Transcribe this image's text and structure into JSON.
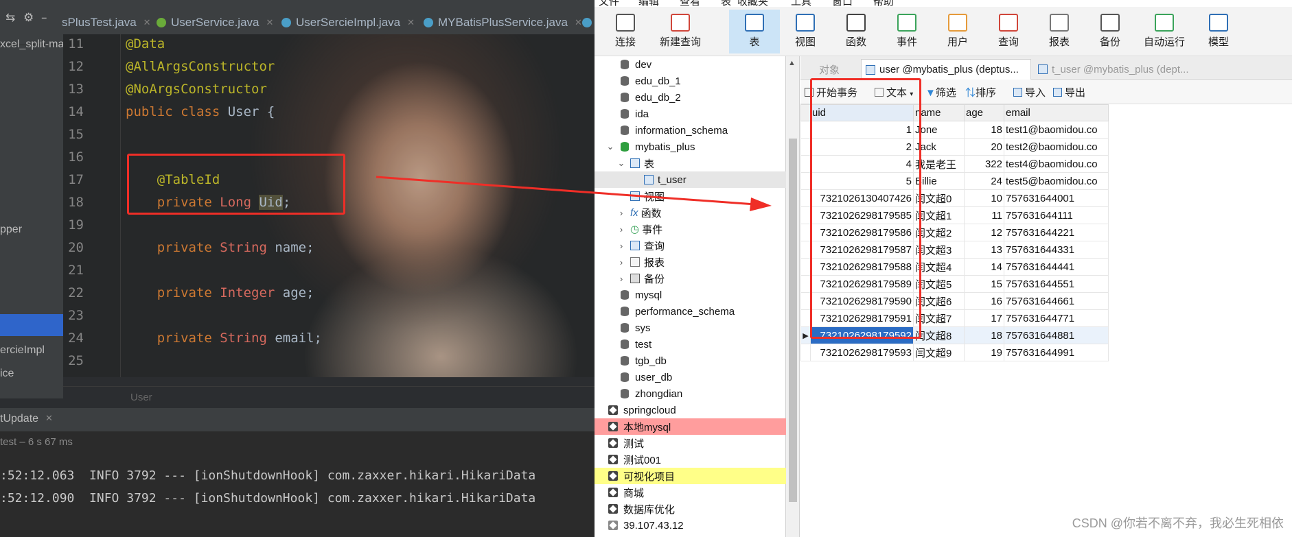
{
  "ide": {
    "tabs": [
      {
        "label": "sPlusTest.java",
        "color": "#4a9ec7"
      },
      {
        "label": "UserService.java",
        "color": "#6aab3a"
      },
      {
        "label": "UserSercieImpl.java",
        "color": "#4a9ec7"
      },
      {
        "label": "MYBatisPlusService.java",
        "color": "#4a9ec7"
      }
    ],
    "project_items": [
      "xcel_split-ma",
      "pper",
      "ercieImpl",
      "ice"
    ],
    "editor": {
      "line_numbers": [
        "11",
        "12",
        "13",
        "14",
        "15",
        "16",
        "17",
        "18",
        "19",
        "20",
        "21",
        "22",
        "23",
        "24",
        "25"
      ],
      "lines": {
        "l11": "@Data",
        "l12": "@AllArgsConstructor",
        "l13": "@NoArgsConstructor",
        "l14_kw": "public class ",
        "l14_name": "User {",
        "l17": "@TableId",
        "l18_kw": "private ",
        "l18_type": "Long ",
        "l18_field": "Uid",
        "l18_end": ";",
        "l20_kw": "private ",
        "l20_type": "String ",
        "l20_field": "name;",
        "l22_kw": "private ",
        "l22_type": "Integer ",
        "l22_field": "age;",
        "l24_kw": "private ",
        "l24_type": "String ",
        "l24_field": "email;"
      }
    },
    "breadcrumb": "User",
    "run_tab": "tUpdate",
    "run_status": "test – 6 s 67 ms",
    "console_lines": [
      ":52:12.063  INFO 3792 --- [ionShutdownHook] com.zaxxer.hikari.HikariData",
      ":52:12.090  INFO 3792 --- [ionShutdownHook] com.zaxxer.hikari.HikariData"
    ]
  },
  "navicat": {
    "menu": [
      "文件",
      "编辑",
      "查看",
      "表",
      "收藏夹",
      "工具",
      "窗口",
      "帮助"
    ],
    "toolbar": [
      {
        "label": "连接",
        "color": "#555555"
      },
      {
        "label": "新建查询",
        "color": "#d0463a"
      },
      {
        "label": "表",
        "color": "#2f6fb5"
      },
      {
        "label": "视图",
        "color": "#2f6fb5"
      },
      {
        "label": "函数",
        "color": "#444444"
      },
      {
        "label": "事件",
        "color": "#3aa35a"
      },
      {
        "label": "用户",
        "color": "#e59a3a"
      },
      {
        "label": "查询",
        "color": "#d0463a"
      },
      {
        "label": "报表",
        "color": "#777777"
      },
      {
        "label": "备份",
        "color": "#555555"
      },
      {
        "label": "自动运行",
        "color": "#3aa35a"
      },
      {
        "label": "模型",
        "color": "#2f6fb5"
      }
    ],
    "tree": {
      "databases_top": [
        "dev",
        "edu_db_1",
        "edu_db_2",
        "ida",
        "information_schema"
      ],
      "open_db": "mybatis_plus",
      "tables_group": "表",
      "selected_table": "t_user",
      "subgroups": [
        "视图",
        "函数",
        "事件",
        "查询",
        "报表",
        "备份"
      ],
      "databases_bottom": [
        "mysql",
        "performance_schema",
        "sys",
        "test",
        "tgb_db",
        "user_db",
        "zhongdian"
      ],
      "connections": [
        {
          "label": "springcloud",
          "highlight": ""
        },
        {
          "label": "本地mysql",
          "highlight": "#ff9d9d"
        },
        {
          "label": "测试",
          "highlight": ""
        },
        {
          "label": "测试001",
          "highlight": ""
        },
        {
          "label": "可视化项目",
          "highlight": "#ffff88"
        },
        {
          "label": "商城",
          "highlight": ""
        },
        {
          "label": "数据库优化",
          "highlight": ""
        },
        {
          "label": "39.107.43.12",
          "highlight": ""
        }
      ]
    },
    "obj_tabs": [
      "对象",
      "user @mybatis_plus (deptus...",
      "t_user @mybatis_plus (dept..."
    ],
    "obj_toolbar": [
      "开始事务",
      "文本",
      "筛选",
      "排序",
      "导入",
      "导出"
    ],
    "grid": {
      "columns": [
        "uid",
        "name",
        "age",
        "email"
      ],
      "rows": [
        [
          "1",
          "Jone",
          "18",
          "test1@baomidou.co"
        ],
        [
          "2",
          "Jack",
          "20",
          "test2@baomidou.co"
        ],
        [
          "4",
          "我是老王",
          "322",
          "test4@baomidou.co"
        ],
        [
          "5",
          "Billie",
          "24",
          "test5@baomidou.co"
        ],
        [
          "7321026130407426",
          "闫文超0",
          "10",
          "757631644001"
        ],
        [
          "7321026298179585",
          "闫文超1",
          "11",
          "757631644111"
        ],
        [
          "7321026298179586",
          "闫文超2",
          "12",
          "757631644221"
        ],
        [
          "7321026298179587",
          "闫文超3",
          "13",
          "757631644331"
        ],
        [
          "7321026298179588",
          "闫文超4",
          "14",
          "757631644441"
        ],
        [
          "7321026298179589",
          "闫文超5",
          "15",
          "757631644551"
        ],
        [
          "7321026298179590",
          "闫文超6",
          "16",
          "757631644661"
        ],
        [
          "7321026298179591",
          "闫文超7",
          "17",
          "757631644771"
        ],
        [
          "7321026298179592",
          "闫文超8",
          "18",
          "757631644881"
        ],
        [
          "7321026298179593",
          "闫文超9",
          "19",
          "757631644991"
        ]
      ],
      "current_row_index": 12
    },
    "watermark": "CSDN @你若不离不弃，我必生死相依"
  }
}
